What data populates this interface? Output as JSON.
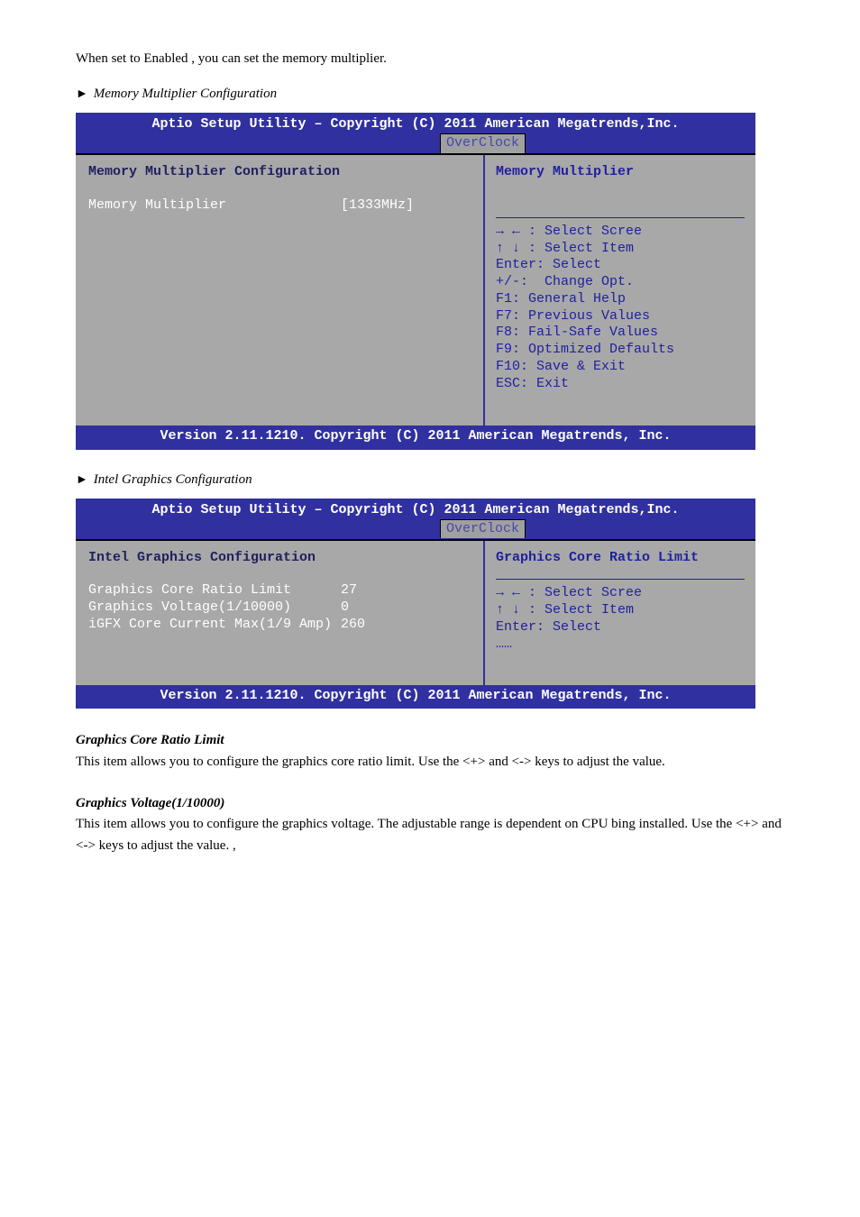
{
  "doc": {
    "intro_line": "When set to Enabled , you can set the memory multiplier.",
    "heading1_arrow": "►",
    "heading1_label": "Memory Multiplier Configuration",
    "heading2_arrow": "►",
    "heading2_label": "Intel Graphics Configuration",
    "body1_title": "Graphics Core Ratio Limit",
    "body1_text": "This item allows you to configure the graphics core ratio limit. Use the <+> and <-> keys to adjust the value.",
    "body2_title": "Graphics Voltage(1/10000)",
    "body2_text": "This item allows you to configure the graphics voltage. The adjustable range is dependent on CPU bing installed. Use the <+> and <-> keys to adjust the value. ,"
  },
  "bios1": {
    "top": "Aptio Setup Utility – Copyright (C) 2011 American Megatrends,Inc.",
    "tab": "OverClock",
    "section_title": "Memory Multiplier Configuration",
    "row1_label": "Memory Multiplier",
    "row1_value": "[1333MHz]",
    "help_title": "Memory Multiplier",
    "keys": {
      "k1": "→ ← : Select Scree",
      "k2": "↑ ↓ : Select Item",
      "k3": "Enter: Select",
      "k4": "+/-:  Change Opt.",
      "k5": "F1: General Help",
      "k6": "F7: Previous Values",
      "k7": "F8: Fail-Safe Values",
      "k8": "F9: Optimized Defaults",
      "k9": "F10: Save & Exit",
      "k10": "ESC: Exit"
    },
    "bottom": "Version 2.11.1210. Copyright (C) 2011 American Megatrends, Inc."
  },
  "bios2": {
    "top": "Aptio Setup Utility – Copyright (C) 2011 American Megatrends,Inc.",
    "tab": "OverClock",
    "section_title": "Intel Graphics Configuration",
    "rows": {
      "r1l": "Graphics Core Ratio Limit",
      "r1v": "27",
      "r2l": "Graphics Voltage(1/10000)",
      "r2v": "0",
      "r3l": "iGFX Core Current Max(1/9 Amp)",
      "r3v": "260"
    },
    "help_title": "Graphics Core Ratio Limit",
    "keys": {
      "k1": "→ ← : Select Scree",
      "k2": "↑ ↓ : Select Item",
      "k3": "Enter: Select",
      "k4": "……"
    },
    "bottom": "Version 2.11.1210. Copyright (C) 2011 American Megatrends, Inc."
  }
}
